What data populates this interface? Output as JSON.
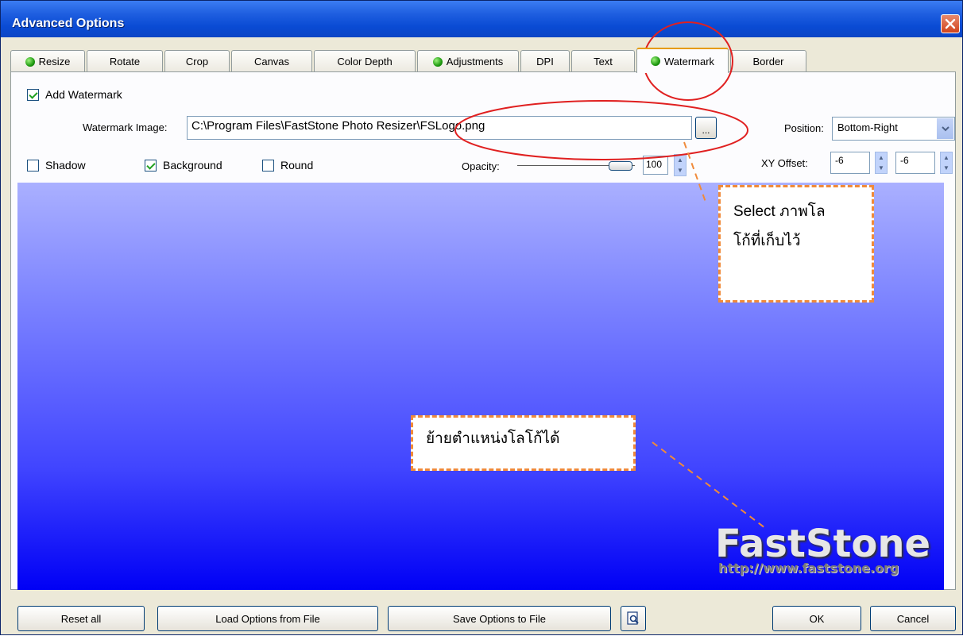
{
  "window": {
    "title": "Advanced Options"
  },
  "tabs": [
    {
      "label": "Resize",
      "has_dot": true
    },
    {
      "label": "Rotate",
      "has_dot": false
    },
    {
      "label": "Crop",
      "has_dot": false
    },
    {
      "label": "Canvas",
      "has_dot": false
    },
    {
      "label": "Color Depth",
      "has_dot": false
    },
    {
      "label": "Adjustments",
      "has_dot": true
    },
    {
      "label": "DPI",
      "has_dot": false
    },
    {
      "label": "Text",
      "has_dot": false
    },
    {
      "label": "Watermark",
      "has_dot": true,
      "active": true
    },
    {
      "label": "Border",
      "has_dot": false
    }
  ],
  "watermark": {
    "add_watermark_label": "Add Watermark",
    "add_watermark_checked": true,
    "image_label": "Watermark Image:",
    "image_path": "C:\\Program Files\\FastStone Photo Resizer\\FSLogo.png",
    "browse_label": "...",
    "position_label": "Position:",
    "position_value": "Bottom-Right",
    "shadow_label": "Shadow",
    "shadow_checked": false,
    "background_label": "Background",
    "background_checked": true,
    "round_label": "Round",
    "round_checked": false,
    "opacity_label": "Opacity:",
    "opacity_value": "100",
    "xy_offset_label": "XY Offset:",
    "x_offset": "-6",
    "y_offset": "-6"
  },
  "preview": {
    "logo_text": "FastStone",
    "logo_url": "http://www.faststone.org"
  },
  "annotations": {
    "select_logo": [
      "Select ภาพโล",
      "โก้ที่เก็บไว้"
    ],
    "move_logo": "ย้ายตำแหน่งโลโก้ได้",
    "color": "#f08a3a"
  },
  "buttons": {
    "reset_all": "Reset all",
    "load_options": "Load Options from File",
    "save_options": "Save Options to File",
    "ok": "OK",
    "cancel": "Cancel"
  },
  "icons": {
    "close": "close-icon",
    "preview": "magnifier-page-icon",
    "dropdown": "chevron-down-icon"
  }
}
